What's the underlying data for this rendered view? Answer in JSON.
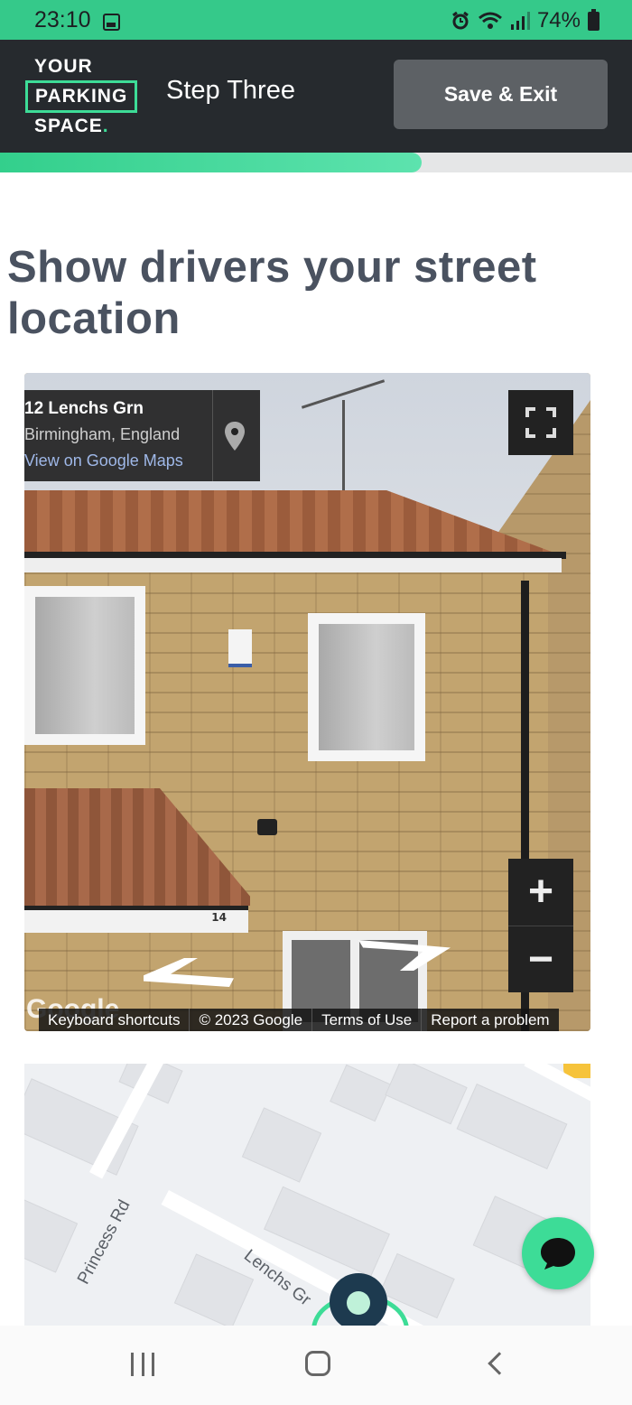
{
  "status_bar": {
    "time": "23:10",
    "battery": "74%",
    "icons": [
      "gallery-icon",
      "alarm-icon",
      "wifi-icon",
      "signal-icon",
      "battery-icon"
    ]
  },
  "header": {
    "logo": {
      "line1": "YOUR",
      "line2": "PARKING",
      "line3": "SPACE",
      "dot": "."
    },
    "step_title": "Step Three",
    "save_exit_label": "Save & Exit"
  },
  "progress": {
    "fraction": 0.667
  },
  "main": {
    "heading": "Show drivers your street location"
  },
  "street_view": {
    "address_name": "12 Lenchs Grn",
    "address_city": "Birmingham, England",
    "maps_link": "View on Google Maps",
    "house_number": "14",
    "watermark": "Google",
    "attribution": {
      "keyboard": "Keyboard shortcuts",
      "copyright": "© 2023 Google",
      "terms": "Terms of Use",
      "report": "Report a problem"
    }
  },
  "map": {
    "road_princess": "Princess Rd",
    "road_lenchs": "Lenchs Gr"
  },
  "colors": {
    "brand_green": "#3ddc97",
    "header_bg": "#262a2e",
    "status_green": "#35c98a"
  }
}
